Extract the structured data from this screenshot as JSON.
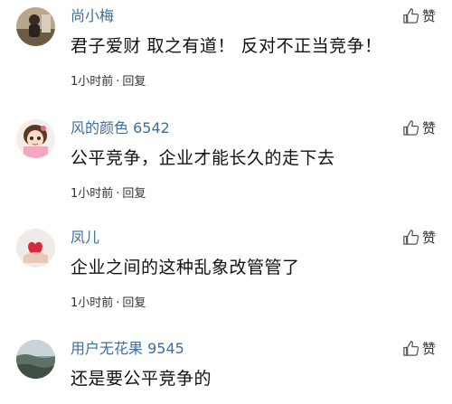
{
  "comments": [
    {
      "username": "尚小梅",
      "text": "君子爱财 取之有道！ 反对不正当竞争！",
      "time": "1小时前",
      "reply_label": "回复",
      "like_label": "赞"
    },
    {
      "username": "风的颜色 6542",
      "text": "公平竞争，企业才能长久的走下去",
      "time": "1小时前",
      "reply_label": "回复",
      "like_label": "赞"
    },
    {
      "username": "凤儿",
      "text": "企业之间的这种乱象改管管了",
      "time": "1小时前",
      "reply_label": "回复",
      "like_label": "赞"
    },
    {
      "username": "用户无花果 9545",
      "text": "还是要公平竞争的",
      "like_label": "赞"
    }
  ],
  "meta_separator": "·",
  "colors": {
    "username": "#3d6e9e",
    "text": "#111111",
    "meta": "#333333"
  }
}
